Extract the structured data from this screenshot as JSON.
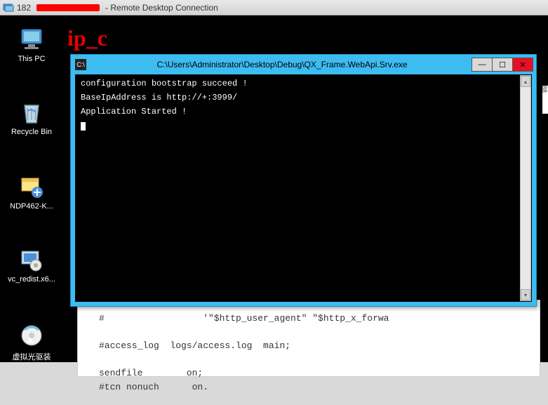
{
  "outer_window": {
    "ip_prefix": "182",
    "title_suffix": " - Remote Desktop Connection"
  },
  "annotation": {
    "ip_label": "ip_c"
  },
  "desktop": {
    "this_pc": "This PC",
    "recycle_bin": "Recycle Bin",
    "ndp": "NDP462-K...",
    "vc_redist": "vc_redist.x6...",
    "virtual_cd": "虚拟光驱装"
  },
  "console": {
    "title": "C:\\Users\\Administrator\\Desktop\\Debug\\QX_Frame.WebApi.Srv.exe",
    "lines": [
      "configuration bootstrap succeed !",
      "BaseIpAddress is http://+:3999/",
      "Application Started !"
    ],
    "buttons": {
      "minimize": "—",
      "maximize": "☐",
      "close": "✕"
    }
  },
  "notepad": {
    "line1": "#                  '\"$http_user_agent\" \"$http_x_forwa",
    "line2": "",
    "line3": "#access_log  logs/access.log  main;",
    "line4": "",
    "line5": "sendfile        on;",
    "line6": "#tcn nonuch      on."
  },
  "right_sliver": "88"
}
